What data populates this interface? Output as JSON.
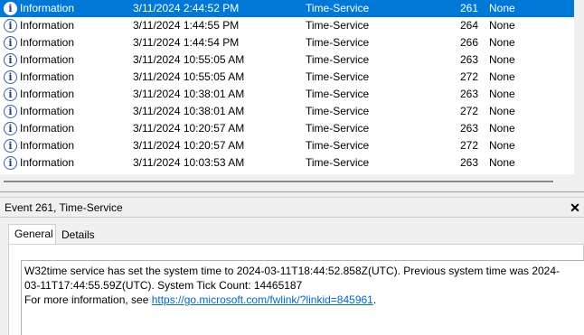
{
  "events": [
    {
      "level": "Information",
      "date": "3/11/2024 2:44:52 PM",
      "source": "Time-Service",
      "event_id": "261",
      "task": "None",
      "selected": true
    },
    {
      "level": "Information",
      "date": "3/11/2024 1:44:55 PM",
      "source": "Time-Service",
      "event_id": "264",
      "task": "None"
    },
    {
      "level": "Information",
      "date": "3/11/2024 1:44:54 PM",
      "source": "Time-Service",
      "event_id": "266",
      "task": "None"
    },
    {
      "level": "Information",
      "date": "3/11/2024 10:55:05 AM",
      "source": "Time-Service",
      "event_id": "263",
      "task": "None"
    },
    {
      "level": "Information",
      "date": "3/11/2024 10:55:05 AM",
      "source": "Time-Service",
      "event_id": "272",
      "task": "None"
    },
    {
      "level": "Information",
      "date": "3/11/2024 10:38:01 AM",
      "source": "Time-Service",
      "event_id": "263",
      "task": "None"
    },
    {
      "level": "Information",
      "date": "3/11/2024 10:38:01 AM",
      "source": "Time-Service",
      "event_id": "272",
      "task": "None"
    },
    {
      "level": "Information",
      "date": "3/11/2024 10:20:57 AM",
      "source": "Time-Service",
      "event_id": "263",
      "task": "None"
    },
    {
      "level": "Information",
      "date": "3/11/2024 10:20:57 AM",
      "source": "Time-Service",
      "event_id": "272",
      "task": "None"
    },
    {
      "level": "Information",
      "date": "3/11/2024 10:03:53 AM",
      "source": "Time-Service",
      "event_id": "263",
      "task": "None"
    }
  ],
  "level_icon": "information-icon",
  "details": {
    "title": "Event 261, Time-Service",
    "close_glyph": "✕",
    "tabs": [
      "General",
      "Details"
    ],
    "active_tab": "General",
    "message_line1": "W32time service has set the system time to 2024-03-11T18:44:52.858Z(UTC). Previous system time was 2024-",
    "message_line2": "03-11T17:44:55.59Z(UTC). System Tick Count: 14465187",
    "more_info_prefix": "For more information, see ",
    "more_info_link": "https://go.microsoft.com/fwlink/?linkid=845961",
    "more_info_suffix": "."
  },
  "colors": {
    "selection": "#0078d7",
    "link": "#0066cc"
  }
}
